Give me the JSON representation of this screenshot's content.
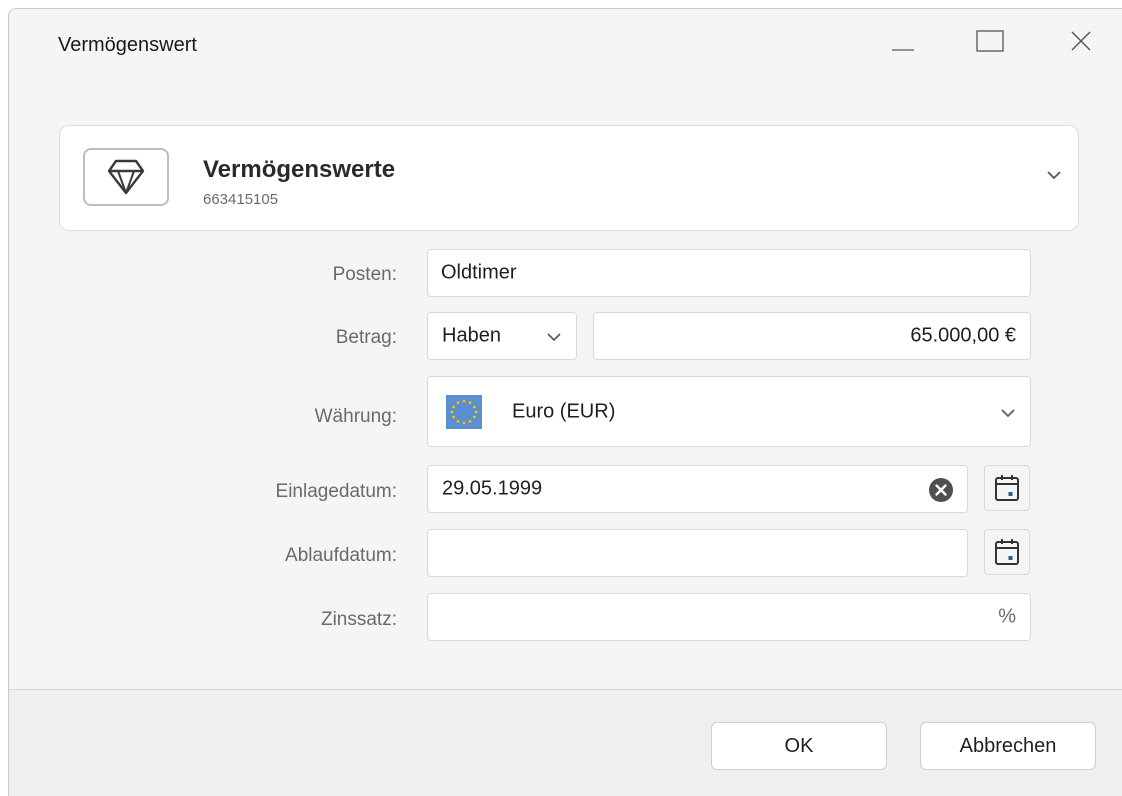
{
  "window": {
    "title": "Vermögenswert",
    "controls": [
      "minimize-icon",
      "maximize-icon",
      "close-icon"
    ]
  },
  "account": {
    "icon": "diamond-icon",
    "name": "Vermögenswerte",
    "number": "663415105"
  },
  "form": {
    "posten": {
      "label": "Posten:",
      "value": "Oldtimer"
    },
    "betrag": {
      "label": "Betrag:",
      "type_value": "Haben",
      "amount": "65.000,00 €"
    },
    "waehrung": {
      "label": "Währung:",
      "value": "Euro (EUR)",
      "flag": "eu-flag-icon"
    },
    "einlagedatum": {
      "label": "Einlagedatum:",
      "value": "29.05.1999"
    },
    "ablaufdatum": {
      "label": "Ablaufdatum:",
      "value": ""
    },
    "zinssatz": {
      "label": "Zinssatz:",
      "value": "",
      "unit": "%"
    }
  },
  "buttons": {
    "ok": "OK",
    "cancel": "Abbrechen"
  },
  "colors": {
    "window_bg": "#f5f5f5",
    "field_bg": "#ffffff",
    "calendar_accent": "#2b5a8a",
    "flag_blue": "#5b8fd0",
    "flag_stars": "#f2c200"
  }
}
